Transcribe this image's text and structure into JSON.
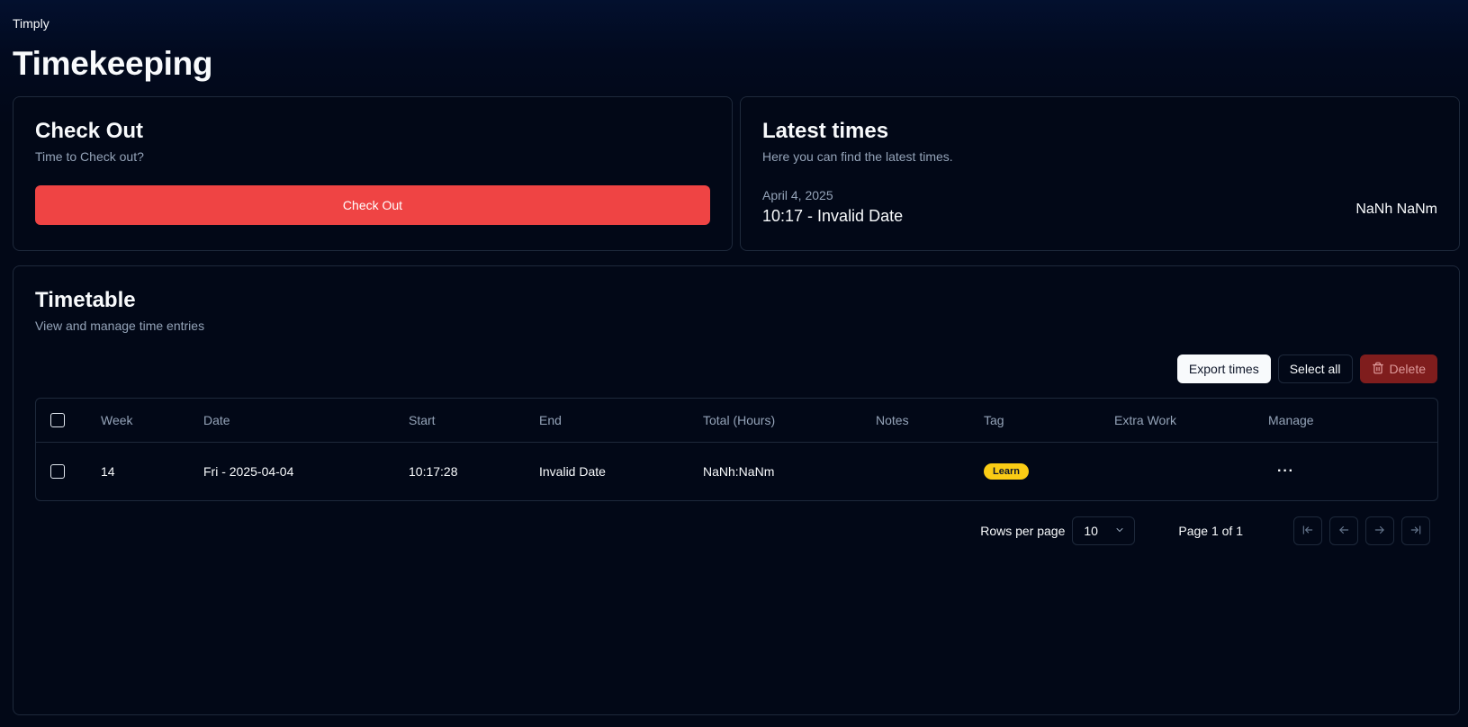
{
  "app": {
    "name": "Timply"
  },
  "page": {
    "title": "Timekeeping"
  },
  "checkout": {
    "title": "Check Out",
    "description": "Time to Check out?",
    "button_label": "Check Out",
    "button_color": "#ef4444"
  },
  "latest": {
    "title": "Latest times",
    "description": "Here you can find the latest times.",
    "date": "April 4, 2025",
    "range": "10:17 - Invalid Date",
    "total": "NaNh NaNm"
  },
  "timetable": {
    "title": "Timetable",
    "description": "View and manage time entries",
    "actions": {
      "export_label": "Export times",
      "select_all_label": "Select all",
      "delete_label": "Delete"
    },
    "columns": [
      "Week",
      "Date",
      "Start",
      "End",
      "Total (Hours)",
      "Notes",
      "Tag",
      "Extra Work",
      "Manage"
    ],
    "rows": [
      {
        "week": "14",
        "date": "Fri - 2025-04-04",
        "start": "10:17:28",
        "end": "Invalid Date",
        "total": "NaNh:NaNm",
        "notes": "",
        "tag": "Learn",
        "extra_work": "",
        "manage": "···"
      }
    ],
    "pagination": {
      "rows_per_page_label": "Rows per page",
      "rows_per_page_value": "10",
      "page_label": "Page 1 of 1"
    }
  }
}
